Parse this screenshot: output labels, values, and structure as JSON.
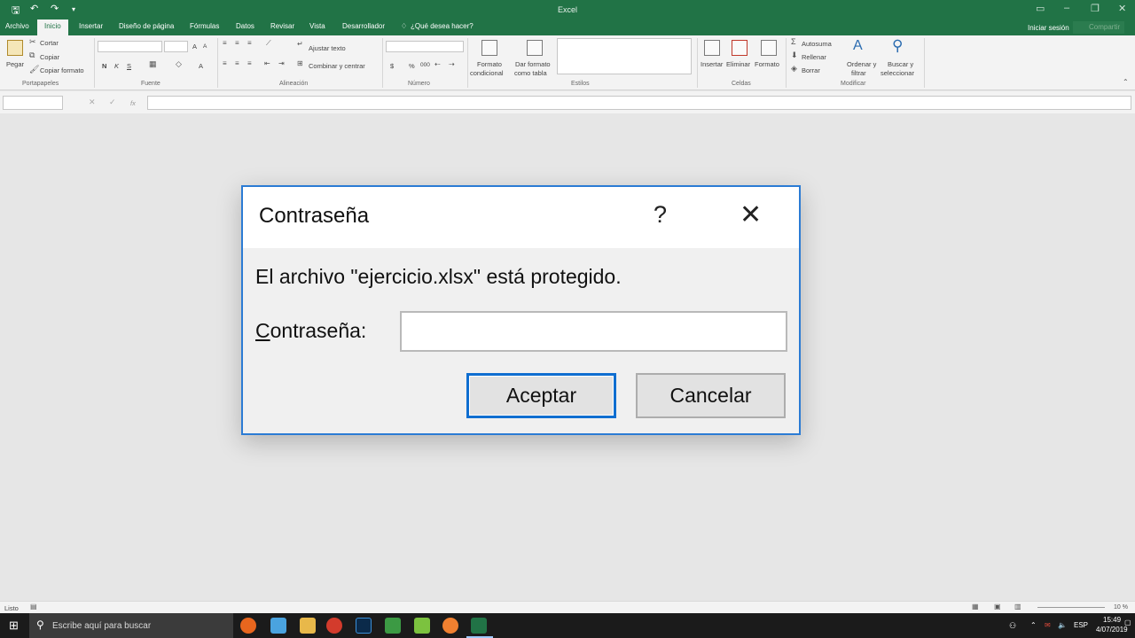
{
  "window": {
    "title": "Excel",
    "signin": "Iniciar sesión",
    "share": "Compartir"
  },
  "tabs": [
    "Archivo",
    "Inicio",
    "Insertar",
    "Diseño de página",
    "Fórmulas",
    "Datos",
    "Revisar",
    "Vista",
    "Desarrollador",
    "¿Qué desea hacer?"
  ],
  "ribbon": {
    "clipboard": {
      "paste": "Pegar",
      "cut": "Cortar",
      "copy": "Copiar",
      "format_painter": "Copiar formato",
      "group": "Portapapeles"
    },
    "font": {
      "bold": "N",
      "italic": "K",
      "underline": "S",
      "grow": "A",
      "shrink": "A",
      "color": "A",
      "group": "Fuente"
    },
    "alignment": {
      "wrap": "Ajustar texto",
      "merge": "Combinar y centrar",
      "group": "Alineación"
    },
    "number": {
      "currency": "$",
      "percent": "%",
      "thousands": "000",
      "group": "Número"
    },
    "styles": {
      "conditional_1": "Formato",
      "conditional_2": "condicional",
      "table_1": "Dar formato",
      "table_2": "como tabla",
      "group": "Estilos"
    },
    "cells": {
      "insert": "Insertar",
      "delete": "Eliminar",
      "format": "Formato",
      "group": "Celdas"
    },
    "editing": {
      "autosum": "Autosuma",
      "fill": "Rellenar",
      "clear": "Borrar",
      "sort_1": "Ordenar y",
      "sort_2": "filtrar",
      "find_1": "Buscar y",
      "find_2": "seleccionar",
      "group": "Modificar"
    }
  },
  "formula_bar": {
    "fx": "fx"
  },
  "dialog": {
    "title": "Contraseña",
    "help": "?",
    "close": "✕",
    "message": "El archivo \"ejercicio.xlsx\" está protegido.",
    "label_first": "C",
    "label_rest": "ontraseña:",
    "input_value": "",
    "ok": "Aceptar",
    "cancel": "Cancelar"
  },
  "status": {
    "text": "Listo",
    "zoom": "10 %"
  },
  "taskbar": {
    "search_placeholder": "Escribe aquí para buscar",
    "lang": "ESP",
    "time": "15:49",
    "date": "4/07/2019"
  },
  "colors": {
    "excel_green": "#217346",
    "dialog_border": "#2b7bd4",
    "button_focus": "#0f6ed0"
  }
}
